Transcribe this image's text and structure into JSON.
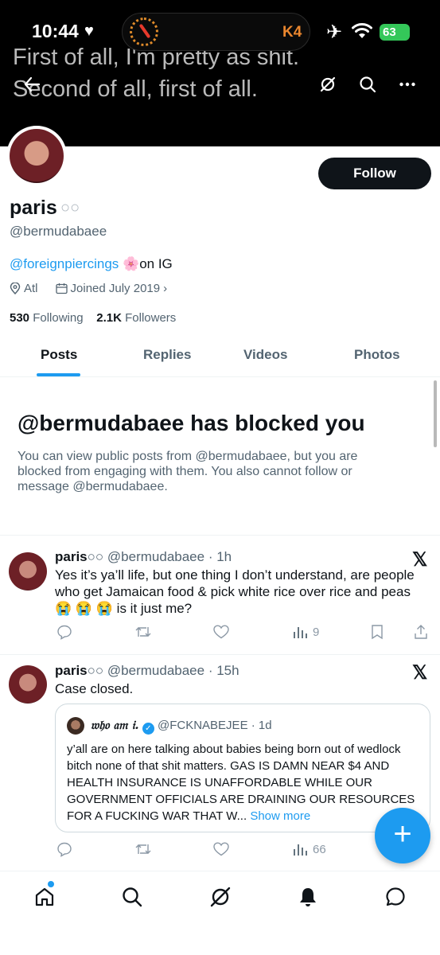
{
  "status_bar": {
    "time": "10:44",
    "island_text": "K4",
    "battery": "63"
  },
  "banner": {
    "line1": "First of all, I'm pretty as shit.",
    "line2": "Second of all, first of all."
  },
  "profile": {
    "display_name": "paris",
    "name_emoji": "○○",
    "handle": "@bermudabaee",
    "bio_link": "@foreignpiercings",
    "bio_emoji": "🌸",
    "bio_rest": "on IG",
    "location": "Atl",
    "joined": "Joined July 2019",
    "following_count": "530",
    "following_label": "Following",
    "followers_count": "2.1K",
    "followers_label": "Followers",
    "follow_label": "Follow"
  },
  "tabs": [
    {
      "label": "Posts",
      "active": true
    },
    {
      "label": "Replies"
    },
    {
      "label": "Videos"
    },
    {
      "label": "Photos"
    }
  ],
  "blocked": {
    "title": "@bermudabaee has blocked you",
    "text": "You can view public posts from @bermudabaee, but you are blocked from engaging with them. You also cannot follow or message @bermudabaee."
  },
  "posts": [
    {
      "name": "paris",
      "handle": "@bermudabaee",
      "time": "· 1h",
      "text": "Yes it’s ya’ll life, but one thing I don’t understand, are people who get Jamaican food & pick white rice over rice and peas😭 😭 😭 is it just me?",
      "views": "9"
    },
    {
      "name": "paris",
      "handle": "@bermudabaee",
      "time": "· 15h",
      "text": "Case closed.",
      "views": "66",
      "quote": {
        "name": "𝔴𝔥𝔬 𝔞𝔪 𝔦.",
        "handle": "@FCKNABEJEE",
        "time": "· 1d",
        "text": "y’all are on here talking about babies being born out of wedlock bitch none of that shit matters. GAS IS DAMN NEAR $4 AND HEALTH INSURANCE IS UNAFFORDABLE WHILE OUR GOVERNMENT OFFICIALS ARE DRAINING OUR RESOURCES FOR A FUCKING WAR THAT W...",
        "show_more": "Show more"
      }
    }
  ],
  "icons": {
    "x_logo": "𝕏",
    "fab": "+"
  },
  "colors": {
    "accent": "#1d9bf0",
    "text": "#0f1419",
    "muted": "#536471"
  }
}
